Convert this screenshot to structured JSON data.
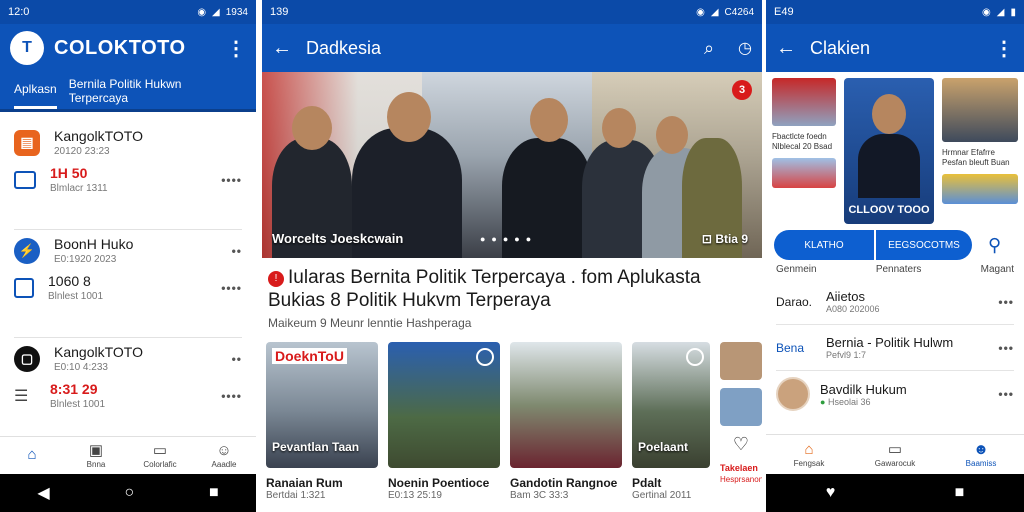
{
  "screen1": {
    "status_time": "12:0",
    "status_battery": "1934",
    "app_title": "COLOKTOTO",
    "logo_glyph": "T",
    "tabs": [
      "Aplkasn",
      "Bernila Politik Hukwn Terpercaya"
    ],
    "cards": [
      {
        "title": "KangolkTOTO",
        "date": "20120 23:23",
        "price": "1H 50",
        "price_sub": "Blmlacr 1311",
        "price_color": "red"
      },
      {
        "title": "BoonH Huko",
        "date": "E0:1920 2023",
        "price": "1060 8",
        "price_sub": "Blnlest 1001",
        "price_color": "dark"
      },
      {
        "title": "KangolkTOTO",
        "date": "E0:10 4:233",
        "price": "8:31 29",
        "price_sub": "Blnlest 1001",
        "price_color": "red"
      }
    ],
    "nav": [
      {
        "label": "",
        "icon": "home-icon"
      },
      {
        "label": "Bnna",
        "icon": "calendar-icon"
      },
      {
        "label": "Colorlafic",
        "icon": "image-icon"
      },
      {
        "label": "Aaadle",
        "icon": "profile-icon"
      }
    ]
  },
  "screen2": {
    "status_time": "139",
    "status_battery": "C4264",
    "title": "Dadkesia",
    "hero_caption": "Worcelts Joeskcwain",
    "hero_meta": "Btia 9",
    "hero_badge": "3",
    "headline": "Iularas Bernita Politik Terpercaya . fom Aplukasta Bukias 8 Politik Hukvm Terperaya",
    "headline_mark": "!",
    "subline": "Maikeum 9 Meunr lenntie Hashperaga",
    "thumbs": [
      {
        "top": "DoeknToU",
        "label": "Pevantlan Taan",
        "caption": "Ranaian Rum",
        "date": "Bertdai 1:321"
      },
      {
        "top": "",
        "label": "",
        "caption": "Noenin Poentioce",
        "date": "E0:13 25:19"
      },
      {
        "top": "",
        "label": "",
        "caption": "Gandotin Rangnoe",
        "date": "Bam 3C 33:3"
      },
      {
        "top": "",
        "label": "Poelaant",
        "caption": "Pdalt",
        "date": "Gertinal 2011"
      }
    ],
    "side_caption": "Takelaen",
    "side_sub": "Hesprsanon"
  },
  "screen3": {
    "status_time": "E49",
    "title": "Clakien",
    "big_label": "CLLOOV TOOO",
    "mini_texts": [
      "Fbactlcte foedn Nlblecal 20 Bsad",
      "Hrmnar Efafrre Pesfan bleuft Buan"
    ],
    "btn_left": "KLATHO",
    "btn_right": "EEGSOCOTMS",
    "labels": [
      "Genmein",
      "Pennaters",
      "Magant"
    ],
    "list": [
      {
        "lead": "Darao.",
        "title": "Aiietos",
        "sub": "A080 202006"
      },
      {
        "lead": "Bena",
        "title": "Bernia - Politik Hulwm",
        "sub": "Pefvl9 1:7"
      },
      {
        "lead": "",
        "title": "Bavdilk Hukum",
        "sub": "Hseolai 36"
      }
    ],
    "nav": [
      {
        "label": "Fengsak",
        "icon": "home-icon"
      },
      {
        "label": "Gawarocuk",
        "icon": "message-icon"
      },
      {
        "label": "Baamiss",
        "icon": "profile-icon"
      }
    ]
  },
  "colors": {
    "primary": "#0d53b8",
    "status": "#0b4aa8",
    "accent_red": "#d81b1b"
  }
}
